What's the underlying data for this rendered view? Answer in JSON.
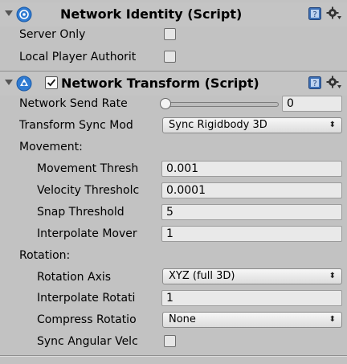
{
  "network_identity": {
    "title": "Network Identity (Script)",
    "icon": "network-identity-icon",
    "fields": {
      "server_only": {
        "label": "Server Only",
        "checked": false
      },
      "local_player_authority": {
        "label": "Local Player Authorit",
        "checked": false
      }
    }
  },
  "network_transform": {
    "title": "Network Transform (Script)",
    "enabled": true,
    "icon": "network-transform-icon",
    "send_rate": {
      "label": "Network Send Rate",
      "value": "0",
      "slider_fraction": 0
    },
    "sync_mode": {
      "label": "Transform Sync Mod",
      "value": "Sync Rigidbody 3D"
    },
    "movement": {
      "header": "Movement:",
      "movement_threshold": {
        "label": "Movement Thresh",
        "value": "0.001"
      },
      "velocity_threshold": {
        "label": "Velocity Thresholc",
        "value": "0.0001"
      },
      "snap_threshold": {
        "label": "Snap Threshold",
        "value": "5"
      },
      "interpolate_movement": {
        "label": "Interpolate Mover",
        "value": "1"
      }
    },
    "rotation": {
      "header": "Rotation:",
      "rotation_axis": {
        "label": "Rotation Axis",
        "value": "XYZ (full 3D)"
      },
      "interpolate_rotation": {
        "label": "Interpolate Rotati",
        "value": "1"
      },
      "compress_rotation": {
        "label": "Compress Rotatio",
        "value": "None"
      },
      "sync_angular_velocity": {
        "label": "Sync Angular Velc",
        "checked": false
      }
    }
  },
  "colors": {
    "panel": "#c2c2c2",
    "field": "#e9e9e9",
    "accent_blue": "#2f7bd2"
  }
}
